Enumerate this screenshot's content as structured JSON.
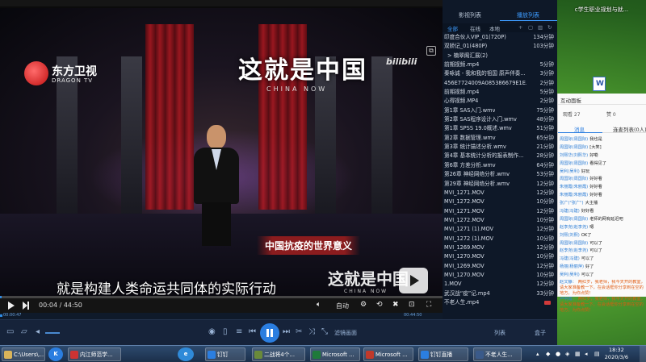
{
  "video": {
    "channel_logo": "东方卫视",
    "channel_logo_sub": "DRAGON TV",
    "show_title": "这就是中国",
    "show_subtitle": "CHINA NOW",
    "bili_watermark": "bilibili",
    "topic_banner": "中国抗疫的世界意义",
    "subtitle": "就是构建人类命运共同体的实际行动",
    "corner_logo": "这就是中国",
    "corner_logo_sub": "CHINA NOW"
  },
  "controls": {
    "time_current": "00:04",
    "time_total": "44:50",
    "time_display": "00:04 / 44:50",
    "quality_label": "自动",
    "progress_fraction": 0.002,
    "mini_time_left": "00:00:47",
    "mini_time_right": "00:44:50"
  },
  "toolbar": {
    "text_edit": "滤镜画面",
    "text_list": "列表",
    "text_box": "盒子"
  },
  "playlist": {
    "tab_video_list": "影视列表",
    "tab_play_list": "播放列表",
    "subtab_all": "全部",
    "subtab_online": "在线",
    "subtab_local": "本地",
    "items": [
      {
        "name": "印度合伙人VIP_01(720P)",
        "duration": "134分钟"
      },
      {
        "name": "双娇记_01(480P)",
        "duration": "103分钟"
      },
      {
        "name": "> 楠翠阁汇展(2)",
        "duration": "",
        "folder": true
      },
      {
        "name": "前期视频.mp4",
        "duration": "5分钟"
      },
      {
        "name": "秦咏诚 - 我和我的祖国 原声伴奏...",
        "duration": "3分钟"
      },
      {
        "name": "456E7724009A085386679E1E...",
        "duration": "2分钟"
      },
      {
        "name": "前期视频.mp4",
        "duration": "5分钟"
      },
      {
        "name": "心得视频.MP4",
        "duration": "2分钟"
      },
      {
        "name": "第1章  SAS入门.wmv",
        "duration": "75分钟"
      },
      {
        "name": "第2章 SAS程序设计入门.wmv",
        "duration": "48分钟"
      },
      {
        "name": "第1章 SPSS 19.0概述.wmv",
        "duration": "51分钟"
      },
      {
        "name": "第2章 数据管理.wmv",
        "duration": "65分钟"
      },
      {
        "name": "第3章 统计描述分析.wmv",
        "duration": "21分钟"
      },
      {
        "name": "第4章 基本统计分析的报表制作...",
        "duration": "28分钟"
      },
      {
        "name": "第6章 方差分析.wmv",
        "duration": "64分钟"
      },
      {
        "name": "第26章 神经网络分析.wmv",
        "duration": "53分钟"
      },
      {
        "name": "第29章 神经网络分析.wmv",
        "duration": "12分钟"
      },
      {
        "name": "MVI_1271.MOV",
        "duration": "12分钟"
      },
      {
        "name": "MVI_1272.MOV",
        "duration": "10分钟"
      },
      {
        "name": "MVI_1271.MOV",
        "duration": "12分钟"
      },
      {
        "name": "MVI_1272.MOV",
        "duration": "10分钟"
      },
      {
        "name": "MVI_1271 (1).MOV",
        "duration": "12分钟"
      },
      {
        "name": "MVI_1272 (1).MOV",
        "duration": "10分钟"
      },
      {
        "name": "MVI_1269.MOV",
        "duration": "12分钟"
      },
      {
        "name": "MVI_1270.MOV",
        "duration": "10分钟"
      },
      {
        "name": "MVI_1269.MOV",
        "duration": "12分钟"
      },
      {
        "name": "MVI_1270.MOV",
        "duration": "10分钟"
      },
      {
        "name": "1.MOV",
        "duration": "12分钟"
      },
      {
        "name": "武汉战“疫”记.mp4",
        "duration": "33分钟"
      },
      {
        "name": "不老人生.mp4",
        "duration": "",
        "badge": true
      }
    ]
  },
  "chat": {
    "panel_title": "互动面板",
    "viewers_label": "观看 27",
    "likes_label": "赞 0",
    "tab_messages": "消息",
    "tab_connect": "连麦列表(0人)",
    "messages": [
      {
        "who": "周国际(周国际)",
        "text": "我也是"
      },
      {
        "who": "周国际(周国际)",
        "text": "[大笑]"
      },
      {
        "who": "刘熙华(刘熙华)",
        "text": "好嘞"
      },
      {
        "who": "周国际(周国际)",
        "text": "看得见了"
      },
      {
        "who": "吴利(吴利)",
        "text": "好玩"
      },
      {
        "who": "周国际(周国际)",
        "text": "好好看"
      },
      {
        "who": "朱丽霞(朱丽霞)",
        "text": "好好看"
      },
      {
        "who": "朱丽霞(朱丽霞)",
        "text": "好好看"
      },
      {
        "who": "张广(\"张广\")",
        "text": "大主播"
      },
      {
        "who": "冯建(冯建)",
        "text": "好好看"
      },
      {
        "who": "周国际(周国际)",
        "text": "老师的网有延迟吧"
      },
      {
        "who": "赵李尧(赵李尧)",
        "text": "嗯"
      },
      {
        "who": "刘熙(刘熙)",
        "text": "OK了"
      },
      {
        "who": "周国际(周国际)",
        "text": "可以了"
      },
      {
        "who": "赵李尧(赵李尧)",
        "text": "可以了"
      },
      {
        "who": "冯建(冯建)",
        "text": "可以了"
      },
      {
        "who": "杨丽(杨丽萍)",
        "text": "好了"
      },
      {
        "who": "吴利(吴利)",
        "text": "可以了"
      }
    ],
    "notices": [
      {
        "who": "赵文静：",
        "text": "两红岁，我老师，我今天开的教室，请大家准备教一下，在会话框你分享到在空的地方，为你点赞！"
      },
      {
        "who": "卢明霞：",
        "text": "两红岁，我老师，我今天开的教室，请大家准备教一下，在会话框你分享到在空的地方，为你点赞！"
      }
    ]
  },
  "desktop": {
    "folder_text": "c学生职业规划与就...",
    "doc_icon_label": ""
  },
  "taskbar": {
    "tasks": [
      {
        "label": "C:\\Users\\..."
      },
      {
        "label": "K"
      },
      {
        "label": "内江师范学..."
      },
      {
        "label": "e"
      },
      {
        "label": "钉钉"
      },
      {
        "label": "二战将4个..."
      },
      {
        "label": "Microsoft ..."
      },
      {
        "label": "Microsoft ..."
      },
      {
        "label": "钉钉直播"
      },
      {
        "label": "不老人生..."
      }
    ],
    "clock_time": "18:32",
    "clock_date": "2020/3/6"
  }
}
